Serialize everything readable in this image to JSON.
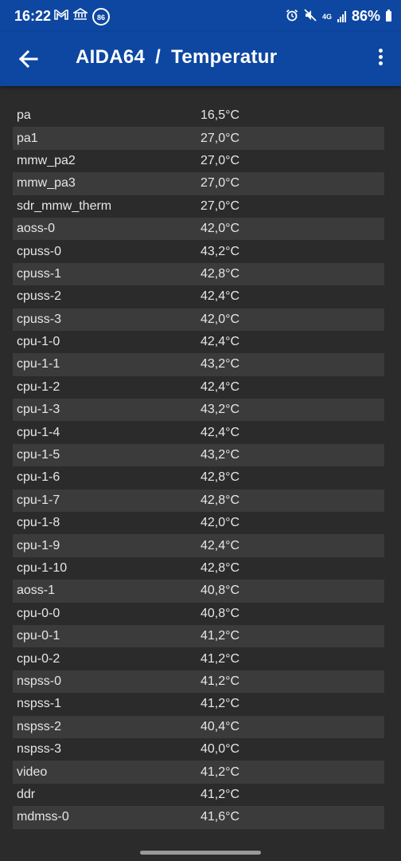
{
  "status_bar": {
    "time": "16:22",
    "notification_badge": "86",
    "network_label": "4G",
    "battery_percent": "86%"
  },
  "app_bar": {
    "app_name": "AIDA64",
    "separator": "/",
    "page_title": "Temperatur"
  },
  "sensors": [
    {
      "name": "pa",
      "value": "16,5°C"
    },
    {
      "name": "pa1",
      "value": "27,0°C"
    },
    {
      "name": "mmw_pa2",
      "value": "27,0°C"
    },
    {
      "name": "mmw_pa3",
      "value": "27,0°C"
    },
    {
      "name": "sdr_mmw_therm",
      "value": "27,0°C"
    },
    {
      "name": "aoss-0",
      "value": "42,0°C"
    },
    {
      "name": "cpuss-0",
      "value": "43,2°C"
    },
    {
      "name": "cpuss-1",
      "value": "42,8°C"
    },
    {
      "name": "cpuss-2",
      "value": "42,4°C"
    },
    {
      "name": "cpuss-3",
      "value": "42,0°C"
    },
    {
      "name": "cpu-1-0",
      "value": "42,4°C"
    },
    {
      "name": "cpu-1-1",
      "value": "43,2°C"
    },
    {
      "name": "cpu-1-2",
      "value": "42,4°C"
    },
    {
      "name": "cpu-1-3",
      "value": "43,2°C"
    },
    {
      "name": "cpu-1-4",
      "value": "42,4°C"
    },
    {
      "name": "cpu-1-5",
      "value": "43,2°C"
    },
    {
      "name": "cpu-1-6",
      "value": "42,8°C"
    },
    {
      "name": "cpu-1-7",
      "value": "42,8°C"
    },
    {
      "name": "cpu-1-8",
      "value": "42,0°C"
    },
    {
      "name": "cpu-1-9",
      "value": "42,4°C"
    },
    {
      "name": "cpu-1-10",
      "value": "42,8°C"
    },
    {
      "name": "aoss-1",
      "value": "40,8°C"
    },
    {
      "name": "cpu-0-0",
      "value": "40,8°C"
    },
    {
      "name": "cpu-0-1",
      "value": "41,2°C"
    },
    {
      "name": "cpu-0-2",
      "value": "41,2°C"
    },
    {
      "name": "nspss-0",
      "value": "41,2°C"
    },
    {
      "name": "nspss-1",
      "value": "41,2°C"
    },
    {
      "name": "nspss-2",
      "value": "40,4°C"
    },
    {
      "name": "nspss-3",
      "value": "40,0°C"
    },
    {
      "name": "video",
      "value": "41,2°C"
    },
    {
      "name": "ddr",
      "value": "41,2°C"
    },
    {
      "name": "mdmss-0",
      "value": "41,6°C"
    }
  ],
  "colors": {
    "app_bar": "#0d47a1",
    "background": "#2b2b2b",
    "row_alt": "#3b3b3b",
    "text": "#e6e6e6"
  }
}
